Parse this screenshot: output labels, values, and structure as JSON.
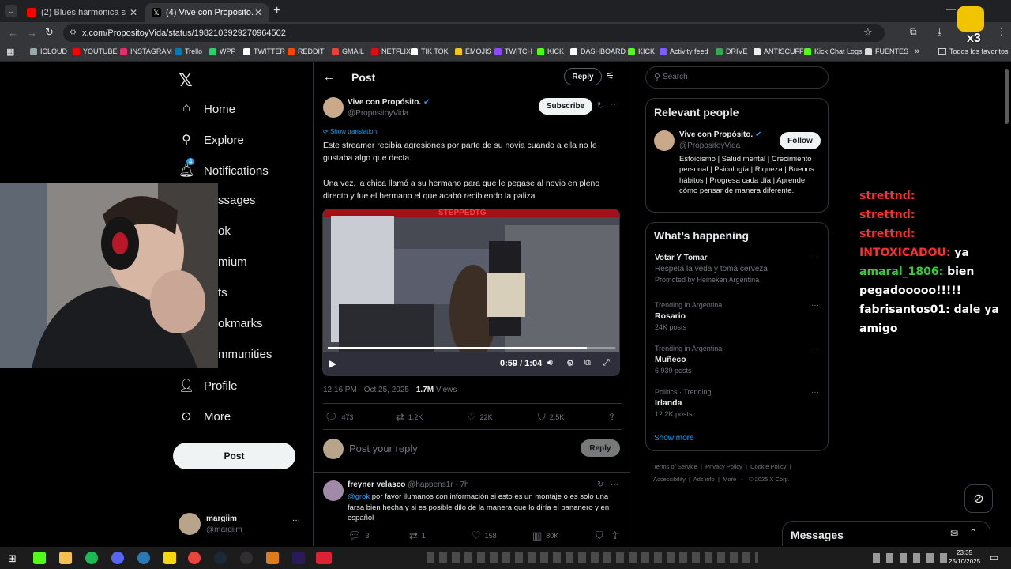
{
  "browser": {
    "tabs": [
      {
        "title": "(2) Blues harmonica solo - YouT",
        "color": "#ff0000"
      },
      {
        "title": "(4) Vive con Propósito. on X: \"E",
        "color": "#ffffff"
      }
    ],
    "new_tab": "+",
    "url": "x.com/PropositoyVida/status/1982103929270964502",
    "bookmarks": [
      "ICLOUD",
      "YOUTUBE",
      "INSTAGRAM",
      "Trello",
      "WPP",
      "TWITTER",
      "REDDIT",
      "GMAIL",
      "NETFLIX",
      "TIK TOK",
      "EMOJIS",
      "TWITCH",
      "KICK",
      "DASHBOARD",
      "KICK",
      "Activity feed",
      "DRIVE",
      "ANTISCUFF",
      "Kick Chat Logs",
      "FUENTES"
    ],
    "bookmarks_more": "»",
    "all_bookmarks": "Todos los favoritos",
    "badge": "x3"
  },
  "nav": {
    "home": "Home",
    "explore": "Explore",
    "notifications": "Notifications",
    "notifications_badge": "4",
    "messages": "ssages",
    "grok": "ok",
    "premium": "mium",
    "lists": "ts",
    "bookmarks": "okmarks",
    "communities": "mmunities",
    "profile": "Profile",
    "more": "More",
    "post_button": "Post",
    "account_name": "margiim",
    "account_handle": "@margiim_",
    "account_more": "···"
  },
  "header": {
    "title": "Post",
    "reply_button": "Reply"
  },
  "post": {
    "author_name": "Vive con Propósito.",
    "author_handle": "@PropositoyVida",
    "subscribe": "Subscribe",
    "show_translation": "Show translation",
    "text_1": "Este streamer recibía agresiones por parte de su novia cuando a ella no le gustaba algo que decía.",
    "text_2": "Una vez, la chica llamó a su hermano para que le pegase al novio en pleno directo y fue el hermano el que acabó recibiendo la paliza",
    "video_watermark": "STEPPEDTG",
    "video_time": "0:59 / 1:04",
    "video_progress": 0.9,
    "timestamp": "12:16 PM · Oct 25, 2025 · ",
    "views_count": "1.7M",
    "views_label": " Views",
    "replies": "473",
    "reposts": "1.2K",
    "likes": "22K",
    "bookmarks": "2.5K",
    "reply_placeholder": "Post your reply",
    "reply_button": "Reply"
  },
  "comment": {
    "name": "freyner velasco",
    "handle_time": "@happens1r · 7h",
    "mention": "@grok",
    "text": " por favor ilumanos con información si esto es un montaje o es solo una farsa bien hecha y si es posible dilo de la manera que lo diría el bananero y en español",
    "replies": "3",
    "reposts": "1",
    "likes": "158",
    "views": "80K"
  },
  "sidebar": {
    "search_placeholder": "Search",
    "relevant_title": "Relevant people",
    "person_name": "Vive con Propósito.",
    "person_handle": "@PropositoyVida",
    "follow": "Follow",
    "person_bio": "Estoicismo | Salud mental | Crecimiento personal | Psicología | Riqueza | Buenos hábitos | Progresa cada día | Aprende cómo pensar de manera diferente.",
    "happening_title": "What’s happening",
    "trends": [
      {
        "context": "Votar Y Tomar",
        "name": "Respetá la veda y tomá cerveza",
        "count": "Promoted by Heineken Argentina"
      },
      {
        "context": "Trending in Argentina",
        "name": "Rosario",
        "count": "24K posts"
      },
      {
        "context": "Trending in Argentina",
        "name": "Muñeco",
        "count": "6,939 posts"
      },
      {
        "context": "Politics · Trending",
        "name": "Irlanda",
        "count": "12.2K posts"
      }
    ],
    "show_more": "Show more",
    "footer_1": "Terms of Service  |  Privacy Policy  |  Cookie Policy  |",
    "footer_2": "Accessibility  |  Ads info  |  More ···   © 2025 X Corp.",
    "messages": "Messages"
  },
  "chat": [
    {
      "user": "strettnd:",
      "msg": "",
      "color": "#ff2d2d"
    },
    {
      "user": "strettnd:",
      "msg": "",
      "color": "#ff2d2d"
    },
    {
      "user": "strettnd:",
      "msg": "",
      "color": "#ff2d2d"
    },
    {
      "user": "INTOXICADOU:",
      "msg": "ya",
      "color": "#ff2d2d"
    },
    {
      "user": "amaral_1806:",
      "msg": "bien",
      "color": "#2fd12f"
    },
    {
      "user": "",
      "msg": "pegadooooo!!!!!",
      "color": "#ff2d2d"
    },
    {
      "user": "fabrisantos01:",
      "msg": "dale ya",
      "color": "#ffffff"
    },
    {
      "user": "",
      "msg": "amigo",
      "color": "#ffffff"
    }
  ],
  "taskbar": {
    "time": "23:35",
    "date": "25/10/2025"
  }
}
